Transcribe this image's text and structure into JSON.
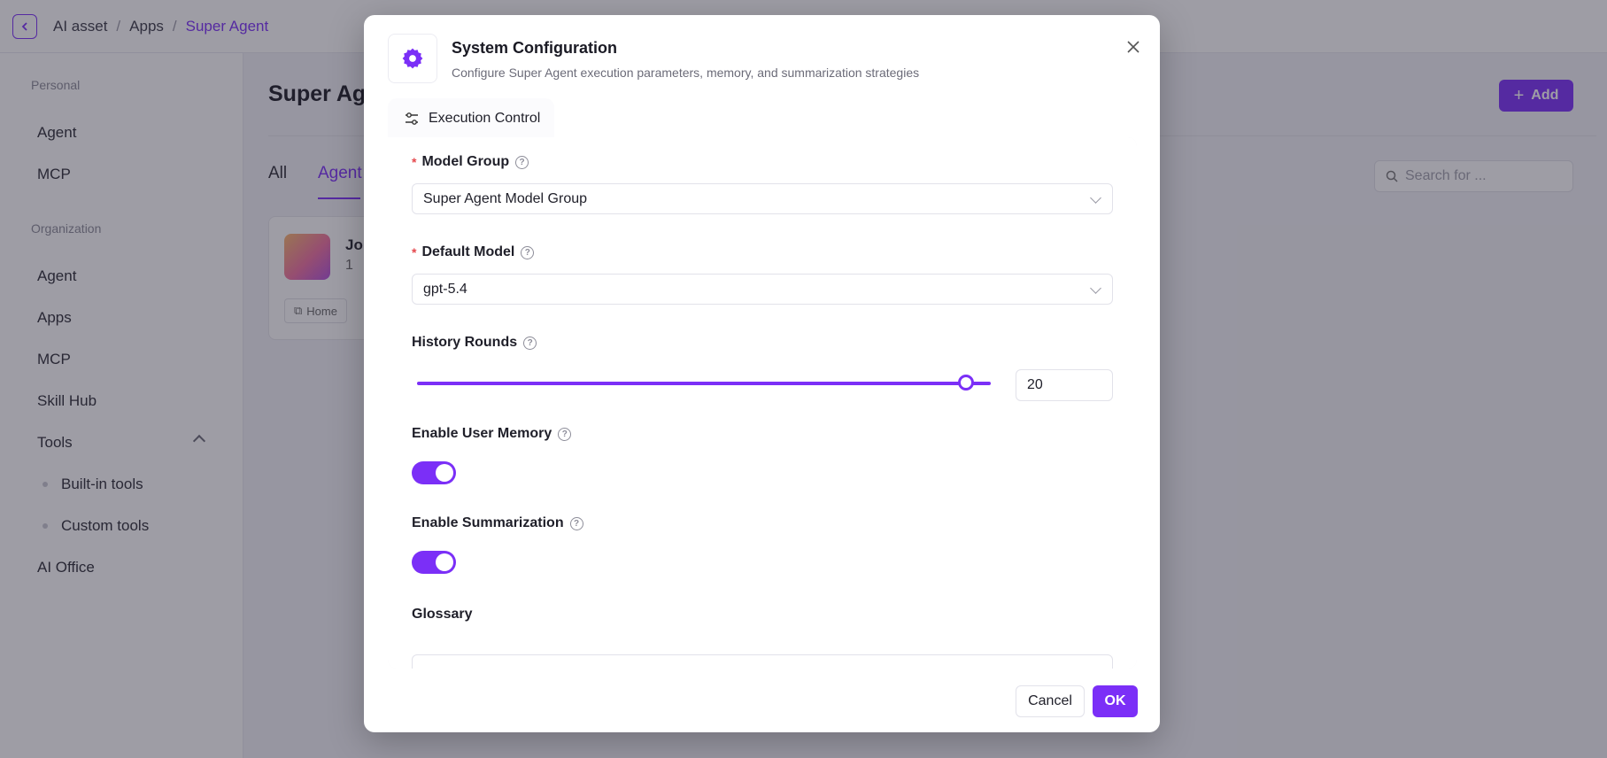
{
  "breadcrumb": {
    "items": [
      "AI asset",
      "Apps",
      "Super Agent"
    ]
  },
  "sidebar": {
    "personal_label": "Personal",
    "personal_items": [
      "Agent",
      "MCP"
    ],
    "org_label": "Organization",
    "org_items": [
      "Agent",
      "Apps",
      "MCP",
      "Skill Hub"
    ],
    "tools_label": "Tools",
    "tools_sub": [
      "Built-in tools",
      "Custom tools"
    ],
    "ai_office": "AI Office"
  },
  "main": {
    "title": "Super Age",
    "add_label": "Add",
    "tabs": [
      "All",
      "Agent"
    ],
    "search_placeholder": "Search for ...",
    "card": {
      "title": "Jo",
      "count": "1",
      "tag": "Home"
    }
  },
  "modal": {
    "title": "System Configuration",
    "subtitle": "Configure Super Agent execution parameters, memory, and summarization strategies",
    "tab_label": "Execution Control",
    "model_group": {
      "label": "Model Group",
      "value": "Super Agent Model Group"
    },
    "default_model": {
      "label": "Default Model",
      "value": "gpt-5.4"
    },
    "history_rounds": {
      "label": "History Rounds",
      "value": "20",
      "fraction": 1.0
    },
    "user_memory": {
      "label": "Enable User Memory",
      "enabled": true
    },
    "summarization": {
      "label": "Enable Summarization",
      "enabled": true
    },
    "glossary": {
      "label": "Glossary"
    },
    "cancel_label": "Cancel",
    "ok_label": "OK"
  },
  "colors": {
    "accent": "#7b2ff7",
    "required": "#e5484d"
  }
}
